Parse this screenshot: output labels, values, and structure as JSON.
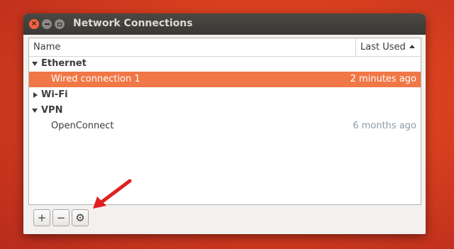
{
  "window": {
    "title": "Network Connections",
    "controls": {
      "close": "×"
    }
  },
  "list": {
    "columns": {
      "name": "Name",
      "last_used": "Last Used"
    },
    "groups": [
      {
        "label": "Ethernet",
        "expanded": true,
        "items": [
          {
            "label": "Wired connection 1",
            "last_used": "2 minutes ago",
            "selected": true
          }
        ]
      },
      {
        "label": "Wi-Fi",
        "expanded": false,
        "items": []
      },
      {
        "label": "VPN",
        "expanded": true,
        "items": [
          {
            "label": "OpenConnect",
            "last_used": "6 months ago",
            "selected": false
          }
        ]
      }
    ]
  },
  "toolbar": {
    "add": "+",
    "remove": "−",
    "settings": "⚙"
  },
  "colors": {
    "selection": "#f07746",
    "titlebar": "#3c3b37",
    "annotation_arrow": "#e02020"
  },
  "icons": [
    "close-icon",
    "minimize-icon",
    "maximize-icon",
    "sort-ascending-icon",
    "expander-down-icon",
    "expander-right-icon",
    "plus-icon",
    "minus-icon",
    "gear-icon",
    "annotation-arrow"
  ]
}
